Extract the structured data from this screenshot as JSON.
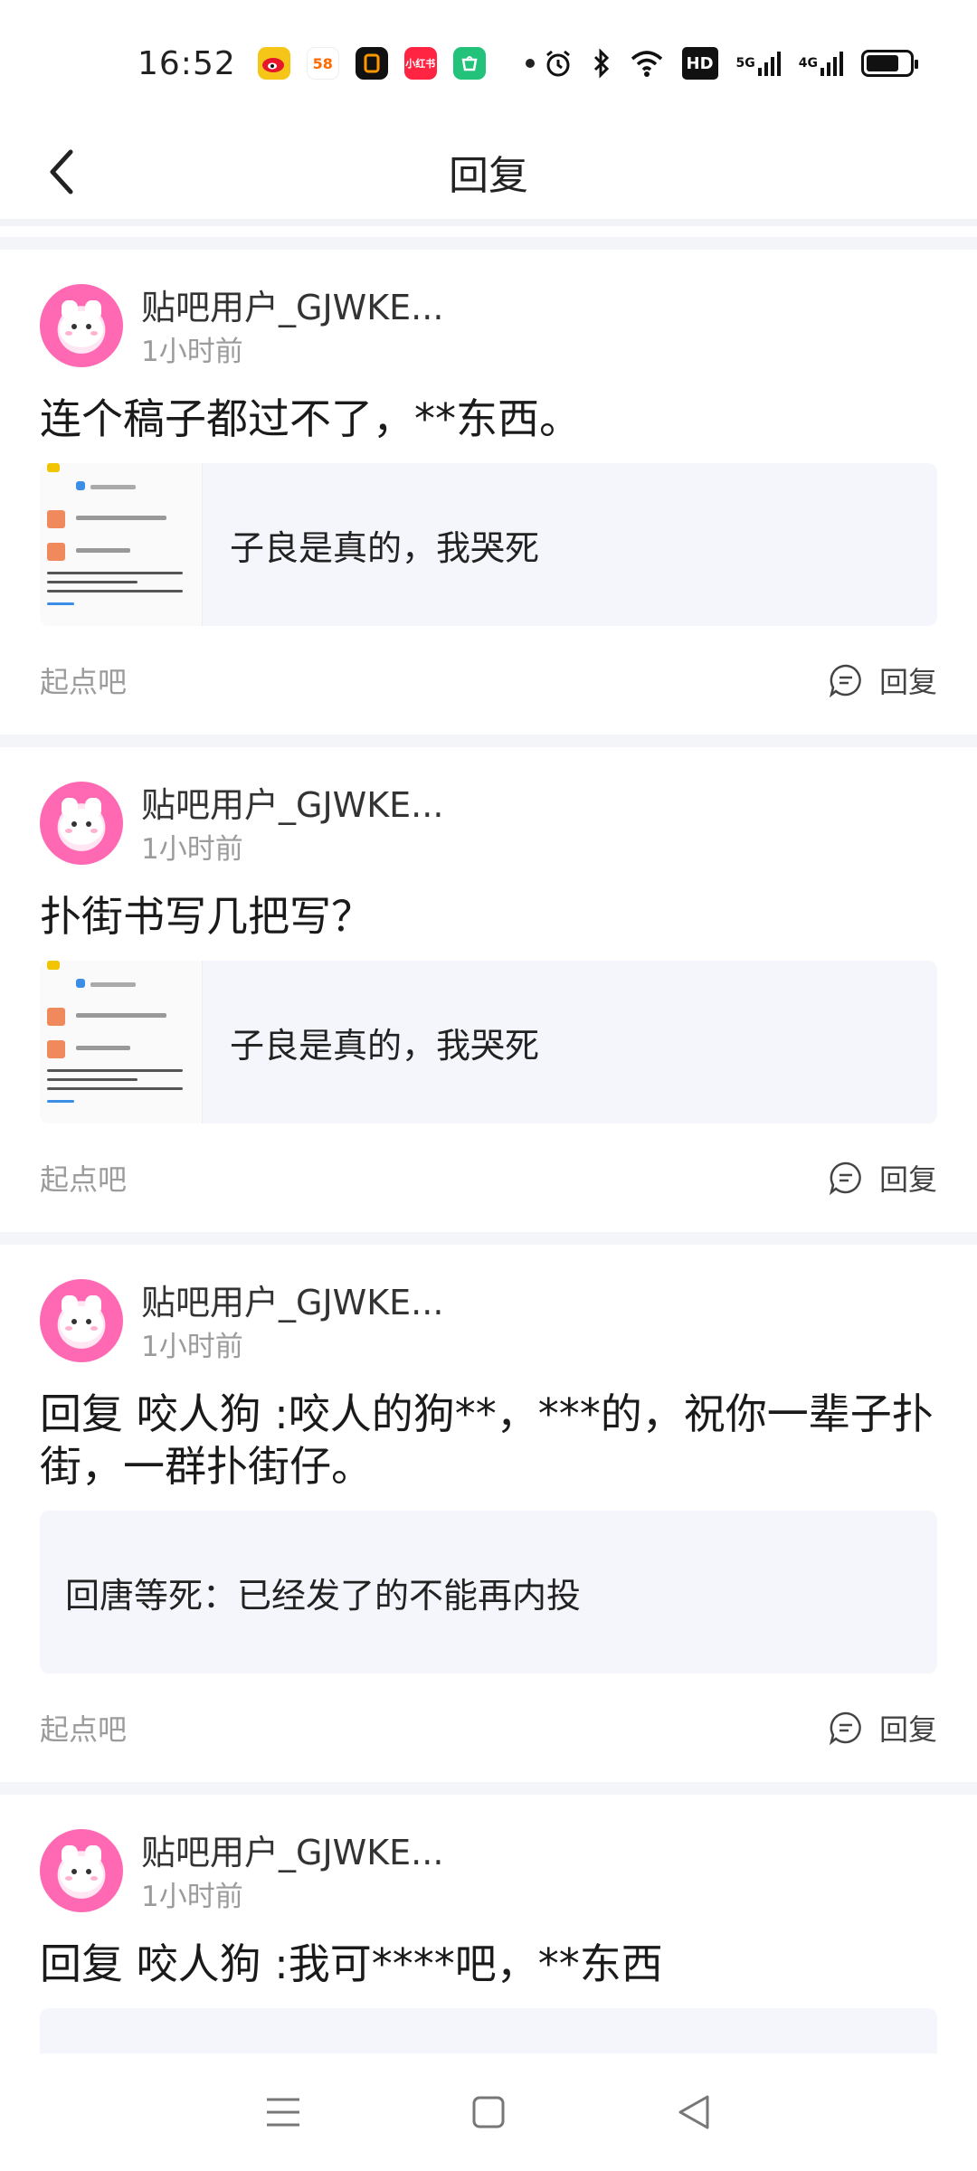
{
  "status_bar": {
    "time": "16:52",
    "apps": [
      {
        "name": "weibo-app-icon",
        "bg": "#f5c518",
        "label": ""
      },
      {
        "name": "58-app-icon",
        "bg": "#ffb300",
        "label": "58"
      },
      {
        "name": "app-black-icon",
        "bg": "#111111",
        "label": ""
      },
      {
        "name": "xiaohongshu-app-icon",
        "bg": "#ff2442",
        "label": "小红书"
      },
      {
        "name": "green-app-icon",
        "bg": "#22c27a",
        "label": ""
      }
    ],
    "network": [
      "HD",
      "5G",
      "4G"
    ]
  },
  "header": {
    "title": "回复"
  },
  "posts": [
    {
      "username": "贴吧用户_GJWKE...",
      "time": "1小时前",
      "content": "连个稿子都过不了，**东西。",
      "quote": "子良是真的，我哭死",
      "has_thumb": true,
      "source": "起点吧",
      "reply_label": "回复"
    },
    {
      "username": "贴吧用户_GJWKE...",
      "time": "1小时前",
      "content": "扑街书写几把写？",
      "quote": "子良是真的，我哭死",
      "has_thumb": true,
      "source": "起点吧",
      "reply_label": "回复"
    },
    {
      "username": "贴吧用户_GJWKE...",
      "time": "1小时前",
      "content": "回复 咬人狗 :咬人的狗**，***的，祝你一辈子扑街，一群扑街仔。",
      "quote": "回唐等死：已经发了的不能再内投",
      "has_thumb": false,
      "source": "起点吧",
      "reply_label": "回复"
    },
    {
      "username": "贴吧用户_GJWKE...",
      "time": "1小时前",
      "content": "回复 咬人狗 :我可****吧，**东西"
    }
  ]
}
